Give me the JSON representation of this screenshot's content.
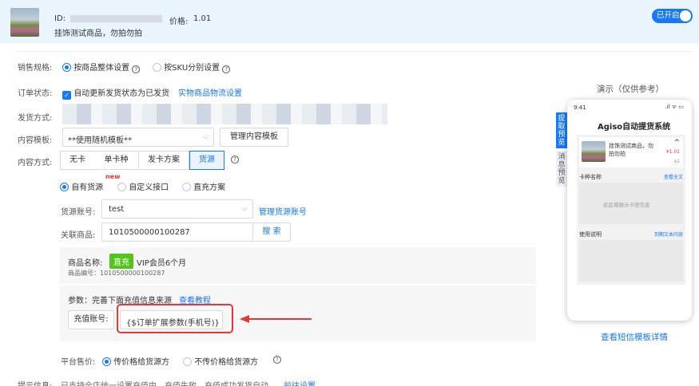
{
  "header": {
    "id_label": "ID:",
    "price_label": "价格:",
    "price_value": "1.01",
    "product_title": "挂饰测试商品，勿拍勿拍",
    "toggle_label": "已开启"
  },
  "sales_spec": {
    "label": "销售规格:",
    "option_whole": "按商品整体设置",
    "option_sku": "按SKU分别设置"
  },
  "order_status": {
    "label": "订单状态:",
    "checkbox_text": "自动更新发货状态为已发货",
    "link": "实物商品物流设置"
  },
  "ship_method": {
    "label": "发货方式:"
  },
  "content_template": {
    "label": "内容模板:",
    "value": "**使用随机模板**",
    "manage_button": "管理内容模板"
  },
  "content_method": {
    "label": "内容方式:",
    "tabs": [
      "无卡",
      "单卡种",
      "发卡方案",
      "货源"
    ],
    "active": "货源"
  },
  "source_type": {
    "option_own": "自有货源",
    "new_badge": "new",
    "option_custom": "自定义接口",
    "option_direct": "直充方案"
  },
  "source_account": {
    "label": "货源账号:",
    "value": "test",
    "manage_link": "管理货源账号"
  },
  "linked_product": {
    "label": "关联商品:",
    "value": "1010500000100287",
    "search_button": "搜 索"
  },
  "product_info": {
    "name_label": "商品名称:",
    "badge": "直充",
    "name": "VIP会员6个月",
    "code_text": "商品编号：1010500000100287"
  },
  "params": {
    "intro_text": "参数：完善下面充值信息来源",
    "tutorial_link": "查看教程",
    "recharge_button": "充值账号:",
    "recharge_value": "{$订单扩展参数(手机号)}"
  },
  "platform_price": {
    "label": "平台售价:",
    "option_pass": "传价格给货源方",
    "option_nopass": "不传价格给货源方"
  },
  "tip": {
    "label": "提示信息:",
    "text": "已支持全店统一设置充值中、充值失败、充值成功发货自动",
    "link": "前往设置"
  },
  "preview": {
    "title": "演示（仅供参考）",
    "tab_pickup": "提取预览",
    "tab_message": "消息预览",
    "phone_time": "9:41",
    "phone_status": ".ıl ᯤ ▭",
    "app_title": "Agiso自动提货系统",
    "product_name": "挂饰测试商品，勿拍勿拍",
    "product_price": "¥1.01",
    "product_qty": "x1",
    "card_label": "卡种名称",
    "card_link": "查看全文",
    "card_placeholder": "此区域展示卡密信息",
    "usage_label": "使用说明",
    "usage_link": "到期文本内容",
    "sms_link": "查看短信模板详情"
  },
  "colors": {
    "accent": "#1677ff",
    "header_bg": "#eaf4fd",
    "badge_green": "#52c41a",
    "highlight_red": "#e53935"
  }
}
